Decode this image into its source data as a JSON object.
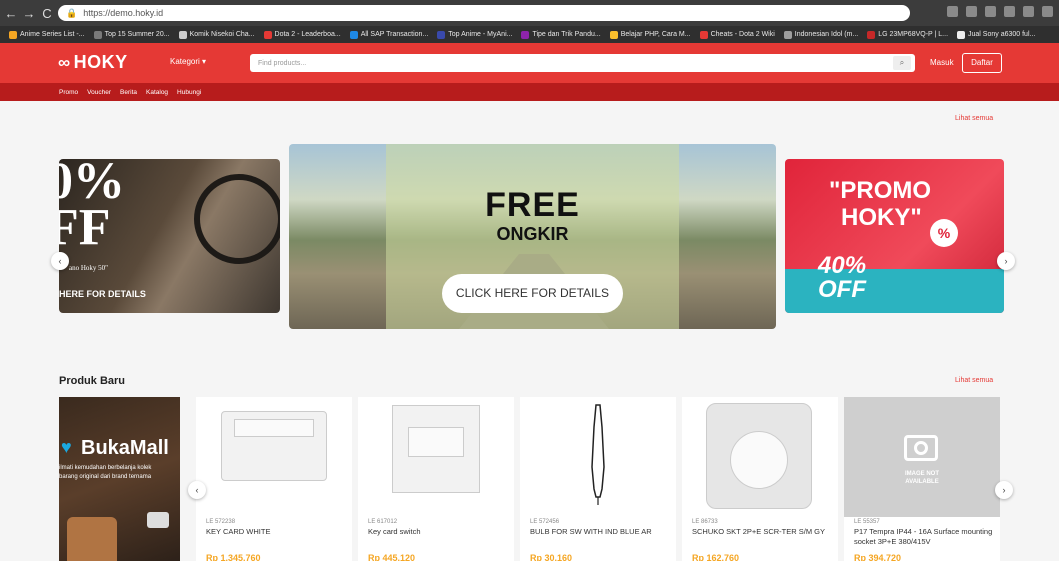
{
  "browser": {
    "url": "https://demo.hoky.id",
    "bookmarks": [
      {
        "label": "Anime Series List -...",
        "color": "#f5a623"
      },
      {
        "label": "Top 15 Summer 20...",
        "color": "#7a7a7a"
      },
      {
        "label": "Komik Nisekoi Cha...",
        "color": "#cccccc"
      },
      {
        "label": "Dota 2 - Leaderboa...",
        "color": "#e53935"
      },
      {
        "label": "All SAP Transaction...",
        "color": "#1e88e5"
      },
      {
        "label": "Top Anime - MyAni...",
        "color": "#3949ab"
      },
      {
        "label": "Tipe dan Trik Pandu...",
        "color": "#8e24aa"
      },
      {
        "label": "Belajar PHP, Cara M...",
        "color": "#fbc02d"
      },
      {
        "label": "Cheats - Dota 2 Wiki",
        "color": "#e53935"
      },
      {
        "label": "Indonesian Idol (m...",
        "color": "#9e9e9e"
      },
      {
        "label": "LG 23MP68VQ-P | L...",
        "color": "#c62828"
      },
      {
        "label": "Jual Sony a6300 ful...",
        "color": "#eeeeee"
      }
    ]
  },
  "header": {
    "logo": "HOKY",
    "kategori": "Kategori ▾",
    "search_placeholder": "Find products...",
    "masuk": "Masuk",
    "daftar": "Daftar"
  },
  "subnav": [
    "Promo",
    "Voucher",
    "Berita",
    "Katalog",
    "Hubungi"
  ],
  "lihat_semua_1": "Lihat semua",
  "banners": {
    "left": {
      "big1": "0%",
      "big2": "FF",
      "small1": "ano Hoky 50\"",
      "small2": "HERE FOR DETAILS"
    },
    "main": {
      "title": "FREE",
      "subtitle": "ONGKIR",
      "cta": "CLICK HERE FOR DETAILS"
    },
    "right": {
      "t1": "\"PROMO",
      "t2": "HOKY\"",
      "t3a": "40%",
      "t3b": "OFF",
      "pct": "%"
    }
  },
  "produk_baru": {
    "title": "Produk Baru",
    "lihat_semua": "Lihat semua",
    "bukamall": {
      "title": "BukaMall",
      "line1": "ilmati kemudahan berbelanja kolek",
      "line2": "barang original dari brand ternama"
    },
    "products": [
      {
        "code": "LE 572238",
        "name": "KEY CARD WHITE",
        "price": "Rp 1.345.760"
      },
      {
        "code": "LE 617012",
        "name": "Key card switch",
        "price": "Rp 445.120"
      },
      {
        "code": "LE 572456",
        "name": "BULB FOR SW WITH IND BLUE AR",
        "price": "Rp 30.160"
      },
      {
        "code": "LE 86733",
        "name": "SCHUKO SKT 2P+E SCR-TER S/M GY",
        "price": "Rp 162.760"
      },
      {
        "code": "LE 55357",
        "name": "P17 Tempra IP44 - 16A Surface mounting socket 3P+E 380/415V",
        "price": "Rp 394.720"
      }
    ],
    "no_image": {
      "line1": "IMAGE NOT",
      "line2": "AVAILABLE"
    }
  },
  "colors": {
    "brand_red": "#e53935",
    "dark_red": "#b71c1c",
    "price": "#f5a623"
  }
}
